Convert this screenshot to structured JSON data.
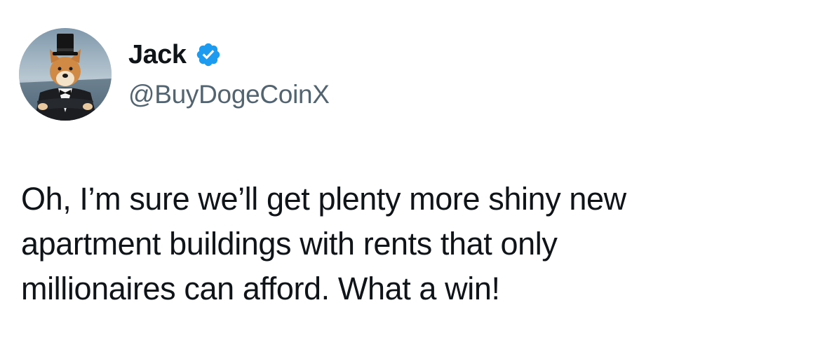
{
  "author": {
    "display_name": "Jack",
    "handle": "@BuyDogeCoinX",
    "verified": true,
    "avatar_icon": "shiba-inu-tuxedo-top-hat-avatar",
    "badge_icon": "verified-badge-icon",
    "badge_color": "#1d9bf0"
  },
  "tweet": {
    "lines": [
      "Oh, I’m sure we’ll get plenty more shiny new",
      "apartment buildings with rents that only",
      "millionaires can afford. What a win!"
    ]
  }
}
